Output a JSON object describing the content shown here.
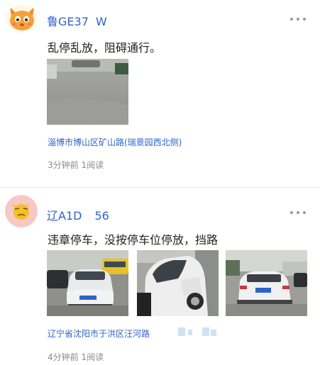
{
  "posts": [
    {
      "username": "鲁GE37",
      "username_suffix": "W",
      "content": "乱停乱放，阻碍通行。",
      "location": "淄博市博山区矿山路(瑞景园西北侧)",
      "meta": "3分钟前 1阅读",
      "avatar_icon": "orange-cat-avatar",
      "photo_count": 1
    },
    {
      "username": "辽A1D",
      "username_suffix": "56",
      "content": "违章停车，没按停车位停放，挡路",
      "location": "辽宁省沈阳市于洪区汪河路",
      "meta": "4分钟前 1阅读",
      "avatar_icon": "yellow-face-avatar",
      "photo_count": 3
    }
  ],
  "colors": {
    "link": "#2f62c9",
    "meta": "#8a8a8a",
    "text": "#222222"
  }
}
